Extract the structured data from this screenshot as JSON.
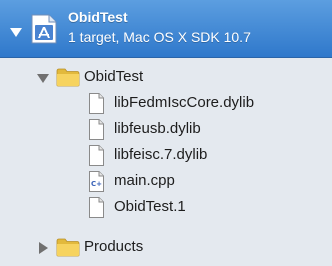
{
  "project": {
    "name": "ObidTest",
    "subtitle": "1 target, Mac OS X SDK 10.7"
  },
  "tree": {
    "group_name": "ObidTest",
    "files": [
      {
        "name": "libFedmIscCore.dylib",
        "icon": "document-icon"
      },
      {
        "name": "libfeusb.dylib",
        "icon": "document-icon"
      },
      {
        "name": "libfeisc.7.dylib",
        "icon": "document-icon"
      },
      {
        "name": "main.cpp",
        "icon": "cpp-source-icon"
      },
      {
        "name": "ObidTest.1",
        "icon": "document-icon"
      }
    ],
    "products_name": "Products"
  },
  "colors": {
    "selection": "#3d87d6",
    "folder": "#f2cf52",
    "background": "#e4e9ef"
  }
}
